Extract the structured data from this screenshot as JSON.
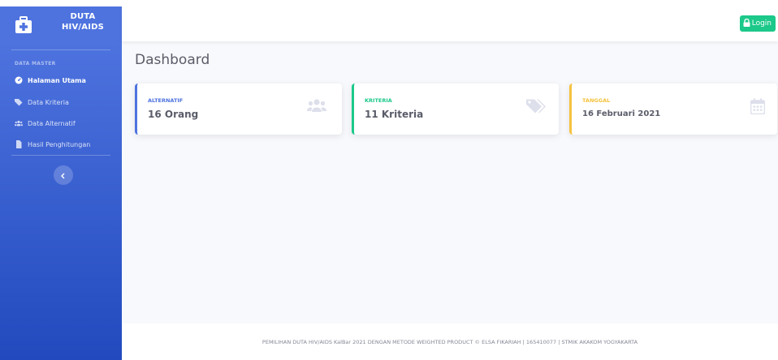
{
  "brand": {
    "line1": "DUTA",
    "line2": "HIV/AIDS"
  },
  "sidebar": {
    "heading": "DATA MASTER",
    "items": [
      {
        "label": "Halaman Utama",
        "icon": "dashboard-icon",
        "active": true
      },
      {
        "label": "Data Kriteria",
        "icon": "tags-icon",
        "active": false
      },
      {
        "label": "Data Alternatif",
        "icon": "users-icon",
        "active": false
      },
      {
        "label": "Hasil Penghitungan",
        "icon": "file-icon",
        "active": false
      }
    ],
    "toggle_icon": "chevron-left-icon"
  },
  "topbar": {
    "login_label": "Login",
    "login_icon": "lock-icon"
  },
  "page": {
    "title": "Dashboard"
  },
  "cards": [
    {
      "label": "ALTERNATIF",
      "value": "16 Orang",
      "icon": "users-icon",
      "color": "#4e73df"
    },
    {
      "label": "KRITERIA",
      "value": "11 Kriteria",
      "icon": "tags-icon",
      "color": "#1cc88a"
    },
    {
      "label": "TANGGAL",
      "value": "16 Februari 2021",
      "icon": "calendar-icon",
      "color": "#f6c23e"
    }
  ],
  "footer": {
    "text": "PEMILIHAN DUTA HIV/AIDS KalBar 2021 DENGAN METODE WEIGHTED PRODUCT © ELSA FIKARIAH | 165410077 | STMIK AKAKOM YOGYAKARTA"
  },
  "colors": {
    "primary": "#4e73df",
    "success": "#1cc88a",
    "warning": "#f6c23e",
    "background": "#f8f9fc"
  }
}
